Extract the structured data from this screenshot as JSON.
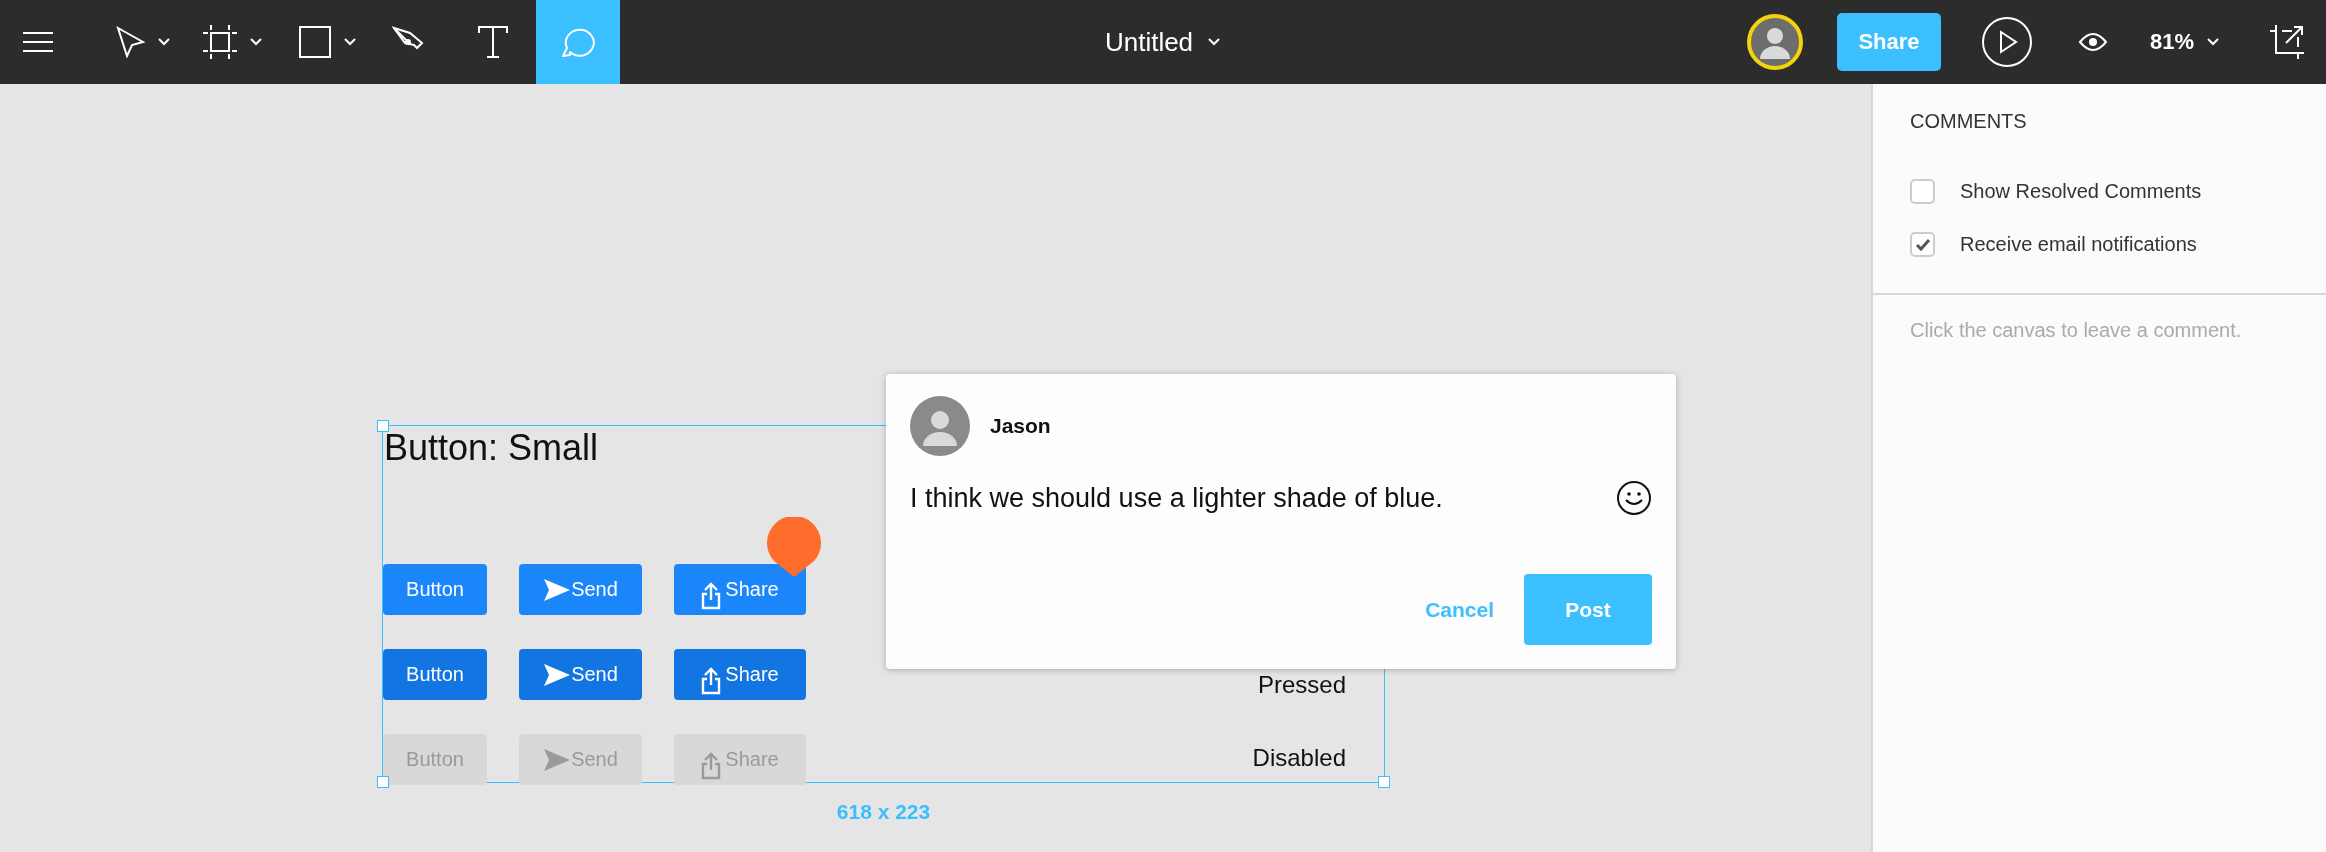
{
  "toolbar": {
    "tools": [
      {
        "kind": "menu",
        "dropdown": false,
        "selected": false
      },
      {
        "kind": "pointer",
        "dropdown": true,
        "selected": false
      },
      {
        "kind": "frame",
        "dropdown": true,
        "selected": false
      },
      {
        "kind": "rectangle",
        "dropdown": true,
        "selected": false
      },
      {
        "kind": "pen",
        "dropdown": false,
        "selected": false
      },
      {
        "kind": "text",
        "dropdown": false,
        "selected": false
      },
      {
        "kind": "comment",
        "dropdown": false,
        "selected": true
      }
    ],
    "title": "Untitled",
    "share_button": "Share",
    "zoom": "81%"
  },
  "canvas": {
    "frame": {
      "title": "Button: Small",
      "size_label": "618 x 223",
      "rows": [
        {
          "kind": "normal",
          "buttons": [
            {
              "kind": "plain",
              "label": "Button"
            },
            {
              "kind": "send",
              "label": "Send"
            },
            {
              "kind": "share",
              "label": "Share"
            }
          ]
        },
        {
          "kind": "pressed",
          "label": "Pressed",
          "buttons": [
            {
              "kind": "plain",
              "label": "Button"
            },
            {
              "kind": "send",
              "label": "Send"
            },
            {
              "kind": "share",
              "label": "Share"
            }
          ]
        },
        {
          "kind": "disabled",
          "label": "Disabled",
          "buttons": [
            {
              "kind": "plain",
              "label": "Button"
            },
            {
              "kind": "send",
              "label": "Send"
            },
            {
              "kind": "share",
              "label": "Share"
            }
          ]
        }
      ]
    },
    "comment_popup": {
      "author": "Jason",
      "message": "I think we should use a lighter shade of blue.",
      "buttons": [
        {
          "kind": "link",
          "label": "Cancel"
        },
        {
          "kind": "primary",
          "label": "Post"
        }
      ]
    }
  },
  "panel": {
    "title": "COMMENTS",
    "options": [
      {
        "label": "Show Resolved Comments",
        "checked": false
      },
      {
        "label": "Receive email notifications",
        "checked": true
      }
    ],
    "hint": "Click the canvas to leave a comment."
  }
}
